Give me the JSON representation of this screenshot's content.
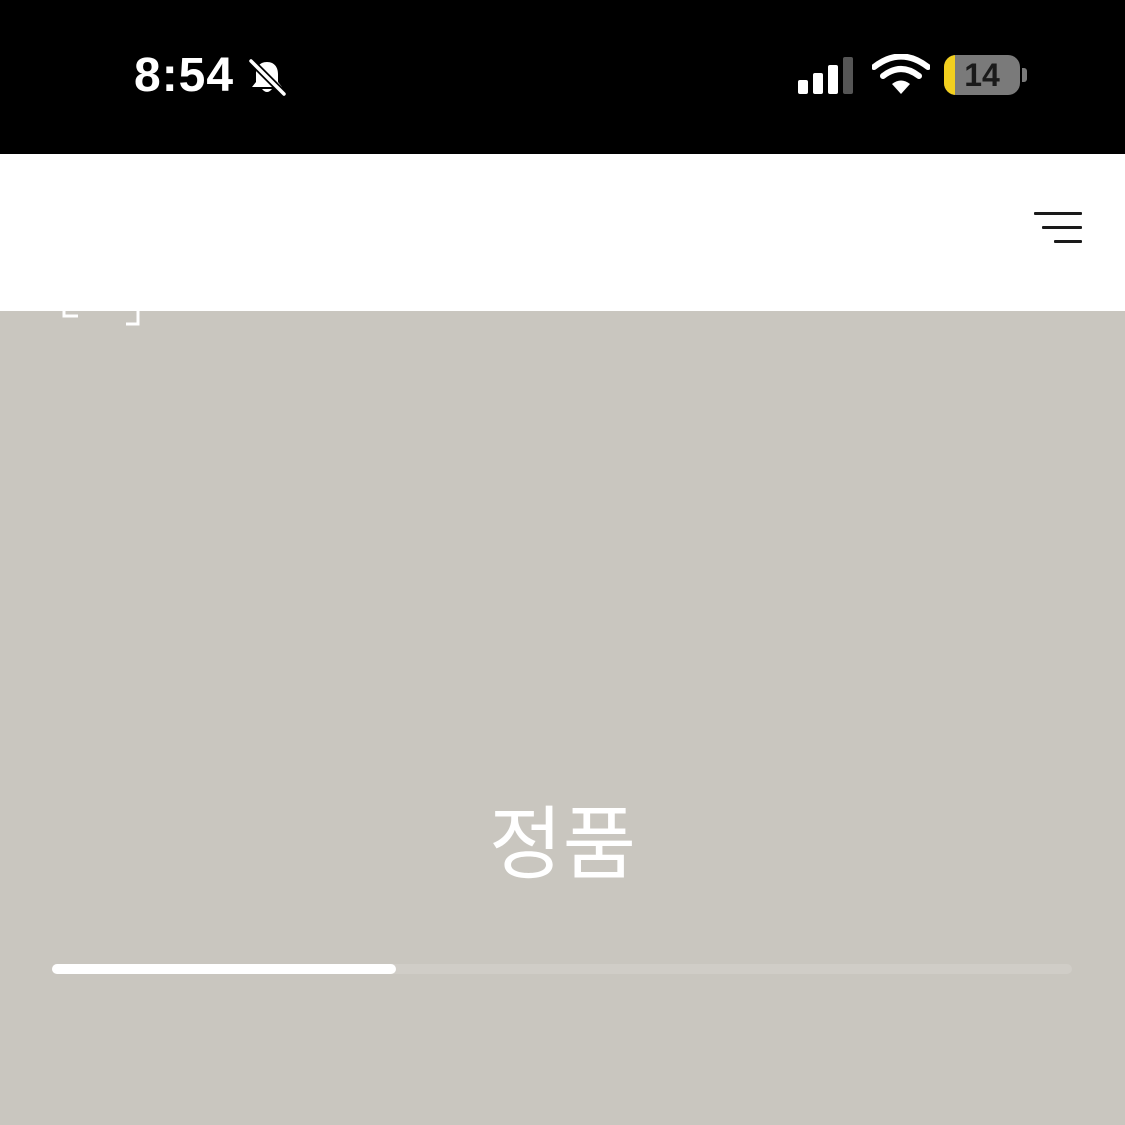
{
  "status_bar": {
    "time": "8:54",
    "battery_level": "14",
    "battery_fraction": 0.14,
    "icons": {
      "bell": "bell-slash-icon",
      "signal": "cellular-signal-icon",
      "wifi": "wifi-icon"
    }
  },
  "header": {
    "menu_icon": "hamburger-menu-icon"
  },
  "hero": {
    "title": "정품",
    "progress_fraction": 0.337
  },
  "colors": {
    "status_bar_bg": "#000000",
    "header_bg": "#ffffff",
    "hero_bg": "#c9c6bf",
    "battery_fill": "#f2cf1e",
    "progress_fill": "#ffffff",
    "progress_track": "#d0cdc7"
  }
}
